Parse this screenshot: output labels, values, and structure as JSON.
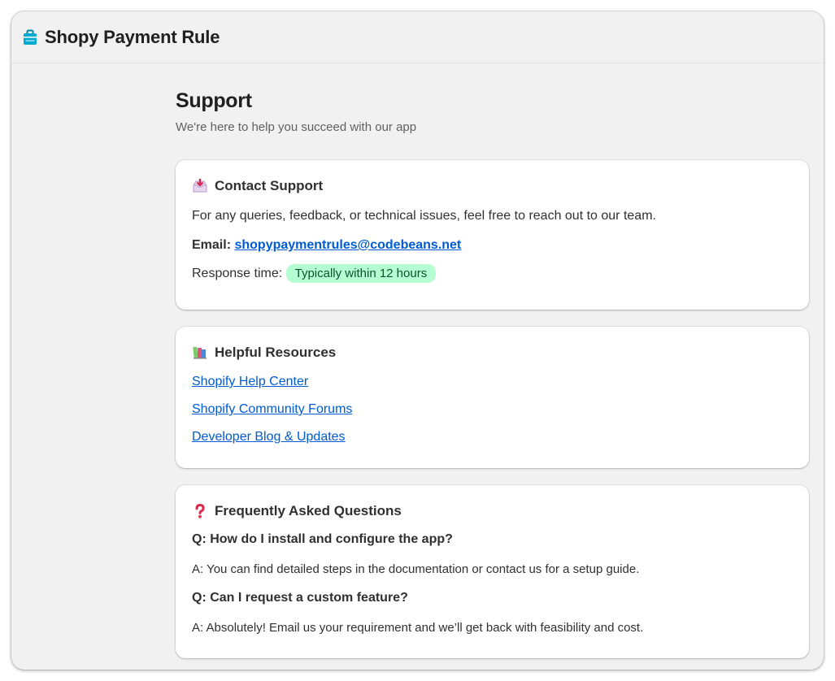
{
  "app": {
    "title": "Shopy Payment Rule",
    "icon": "shopping-bag-icon",
    "accent": "#00a0c6"
  },
  "page": {
    "title": "Support",
    "subtitle": "We're here to help you succeed with our app"
  },
  "contact": {
    "heading": "Contact Support",
    "icon": "inbox-tray-icon",
    "description": "For any queries, feedback, or technical issues, feel free to reach out to our team.",
    "email_label": "Email:",
    "email": "shopypaymentrules@codebeans.net",
    "response_label": "Response time:",
    "response_value": "Typically within 12 hours",
    "badge_color": "#b4fed2"
  },
  "resources": {
    "heading": "Helpful Resources",
    "icon": "books-icon",
    "links": [
      "Shopify Help Center",
      "Shopify Community Forums",
      "Developer Blog & Updates"
    ],
    "link_color": "#005bd3"
  },
  "faq": {
    "heading": "Frequently Asked Questions",
    "icon": "question-mark-icon",
    "items": [
      {
        "q": "Q: How do I install and configure the app?",
        "a": "A: You can find detailed steps in the documentation or contact us for a setup guide."
      },
      {
        "q": "Q: Can I request a custom feature?",
        "a": "A: Absolutely! Email us your requirement and we’ll get back with feasibility and cost."
      }
    ]
  }
}
